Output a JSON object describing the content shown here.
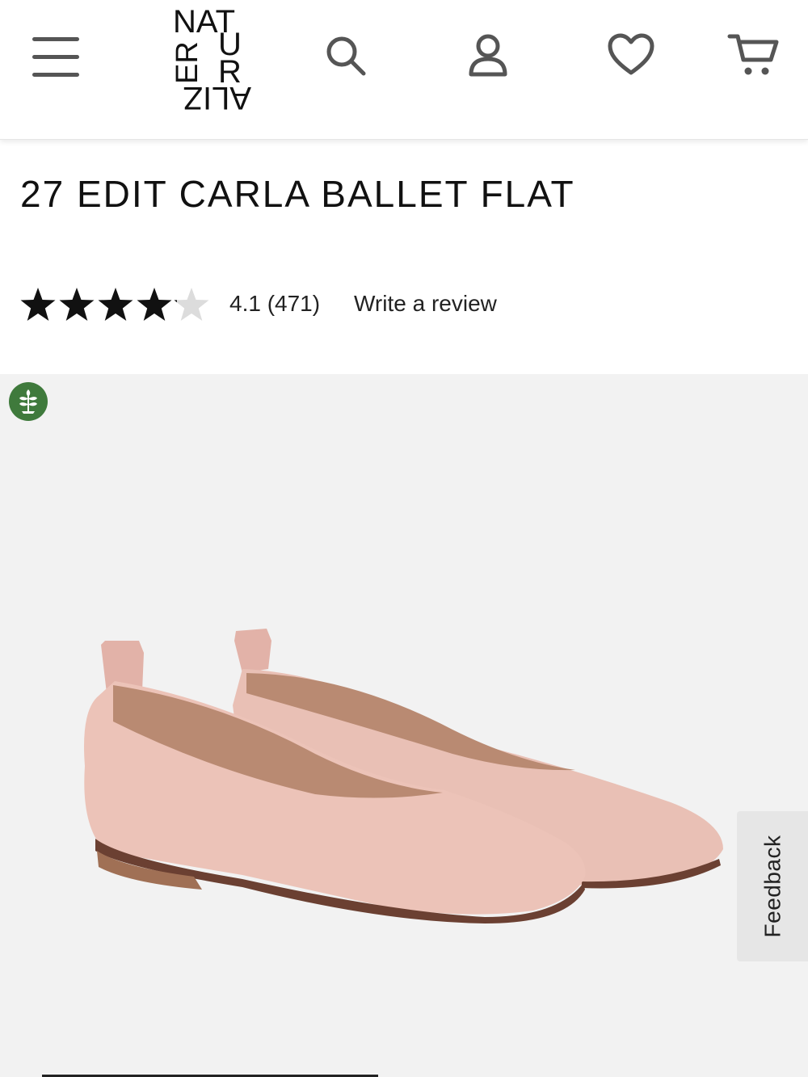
{
  "header": {
    "logo_text": "NATURALIZER",
    "icons": [
      "menu-icon",
      "search-icon",
      "account-icon",
      "heart-icon",
      "cart-icon"
    ]
  },
  "product": {
    "title": "27 EDIT CARLA BALLET FLAT",
    "rating_value": 4.1,
    "rating_display": "4.1 (471)",
    "review_link": "Write a review",
    "stars_max": 5
  },
  "feedback": {
    "label": "Feedback"
  },
  "colors": {
    "text": "#111111",
    "star_filled": "#111111",
    "star_empty": "#dcdcdc",
    "badge_green": "#3f7a3c",
    "image_bg": "#f2f2f2",
    "shoe": "#e8bfb4"
  }
}
